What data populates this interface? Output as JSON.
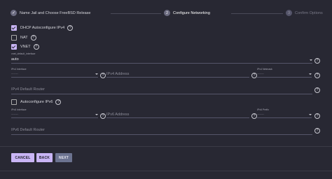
{
  "stepper": {
    "steps": [
      {
        "index": "✓",
        "label": "Name Jail and Choose FreeBSD Release",
        "state": "done"
      },
      {
        "index": "2",
        "label": "Configure Networking",
        "state": "active"
      },
      {
        "index": "3",
        "label": "Confirm Options",
        "state": "todo"
      }
    ]
  },
  "form": {
    "dhcp": {
      "label": "DHCP Autoconfigure IPv4",
      "checked": true
    },
    "nat": {
      "label": "NAT",
      "checked": false
    },
    "vnet": {
      "label": "VNET",
      "checked": true
    },
    "vnet_default_interface": {
      "label": "vnet_default_interface",
      "value": "auto"
    },
    "ipv4_interface": {
      "label": "IPv4 Interface",
      "value": "------"
    },
    "ipv4_address": {
      "placeholder": "IPv4 Address"
    },
    "ipv4_netmask": {
      "label": "IPv4 Netmask",
      "value": "------"
    },
    "ipv4_default_router": {
      "placeholder": "IPv4 Default Router"
    },
    "autoconfigure_ipv6": {
      "label": "Autoconfigure IPv6",
      "checked": false
    },
    "ipv6_interface": {
      "label": "IPv6 Interface",
      "value": "------"
    },
    "ipv6_address": {
      "placeholder": "IPv6 Address"
    },
    "ipv6_prefix": {
      "label": "IPv6 Prefix",
      "value": "------"
    },
    "ipv6_default_router": {
      "placeholder": "IPv6 Default Router"
    }
  },
  "buttons": {
    "cancel": "CANCEL",
    "back": "BACK",
    "next": "NEXT"
  },
  "colors": {
    "accent": "#c9b5f5",
    "background": "#282833",
    "next_button": "#6c7390"
  }
}
